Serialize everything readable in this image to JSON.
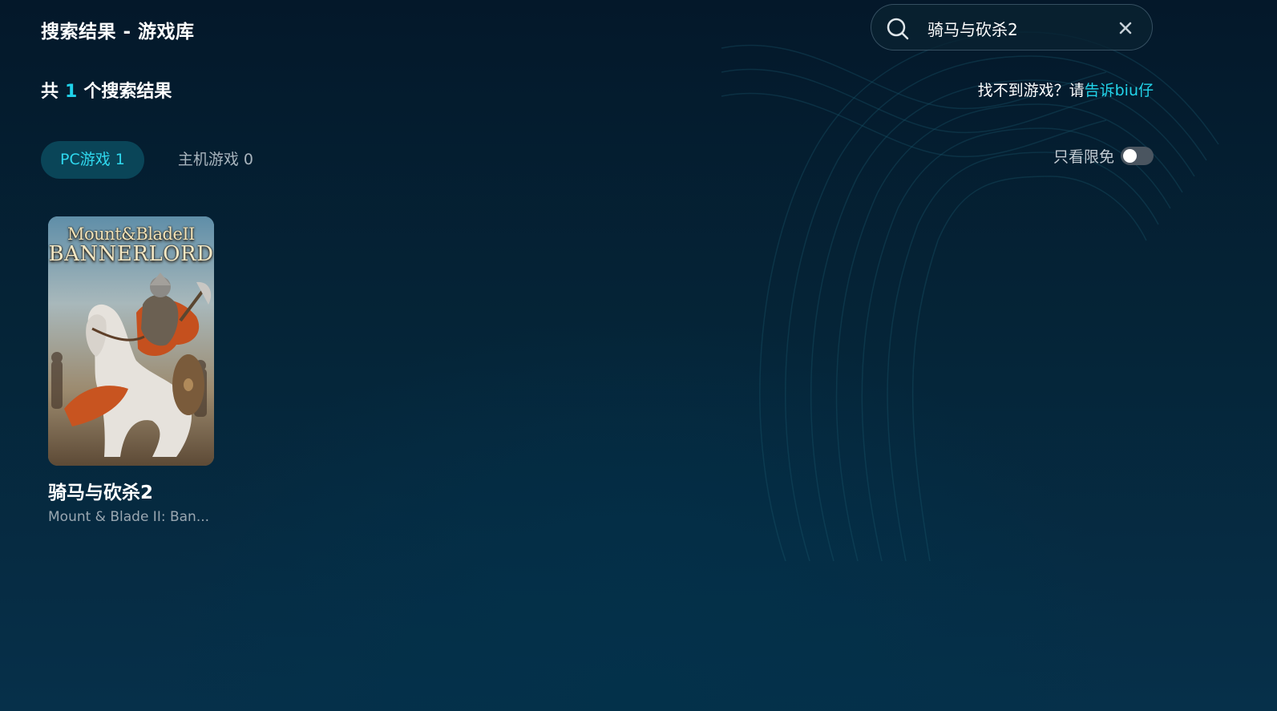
{
  "header": {
    "title": "搜索结果 - 游戏库"
  },
  "search": {
    "value": "骑马与砍杀2",
    "search_icon": "search-icon",
    "clear_icon": "close-icon"
  },
  "results": {
    "prefix": "共",
    "count": "1",
    "suffix": "个搜索结果"
  },
  "feedback": {
    "text": "找不到游戏？请",
    "link": "告诉biu仔"
  },
  "tabs": [
    {
      "label": "PC游戏",
      "count": "1",
      "active": true
    },
    {
      "label": "主机游戏",
      "count": "0",
      "active": false
    }
  ],
  "filter": {
    "label": "只看限免",
    "enabled": false
  },
  "games": [
    {
      "title": "骑马与砍杀2",
      "subtitle": "Mount & Blade II: Ban...",
      "cover_line1": "Mount&BladeII",
      "cover_line2": "BANNERLORD"
    }
  ],
  "colors": {
    "accent": "#22d4ea",
    "tab_active_bg": "#0a4558",
    "background": "#052437"
  }
}
